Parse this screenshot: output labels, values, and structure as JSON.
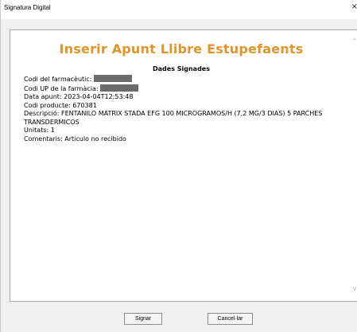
{
  "window": {
    "title": "Signatura Digital",
    "close_glyph": "×"
  },
  "content": {
    "heading": "Inserir Apunt Llibre Estupefaents",
    "subheading": "Dades Signades",
    "fields": {
      "codi_farmaceutic": "Codi del farmacèutic:",
      "codi_up": "Codi UP de la farmàcia:",
      "data_apunt": "Data apunt: 2023-04-04T12:53:48",
      "codi_producte": "Codi producte: 670381",
      "descripcio": "Descripció: FENTANILO MATRIX STADA EFG 100 MICROGRAMOS/H (7,2 MG/3 DIAS) 5 PARCHES TRANSDERMICOS",
      "unitats": "Unitats: 1",
      "comentaris": "Comentaris: Articulo no recibido"
    },
    "scroll_up_glyph": "^",
    "scroll_down_glyph": "v"
  },
  "buttons": {
    "sign_label": "Signar",
    "cancel_label": "Cancel·lar"
  }
}
